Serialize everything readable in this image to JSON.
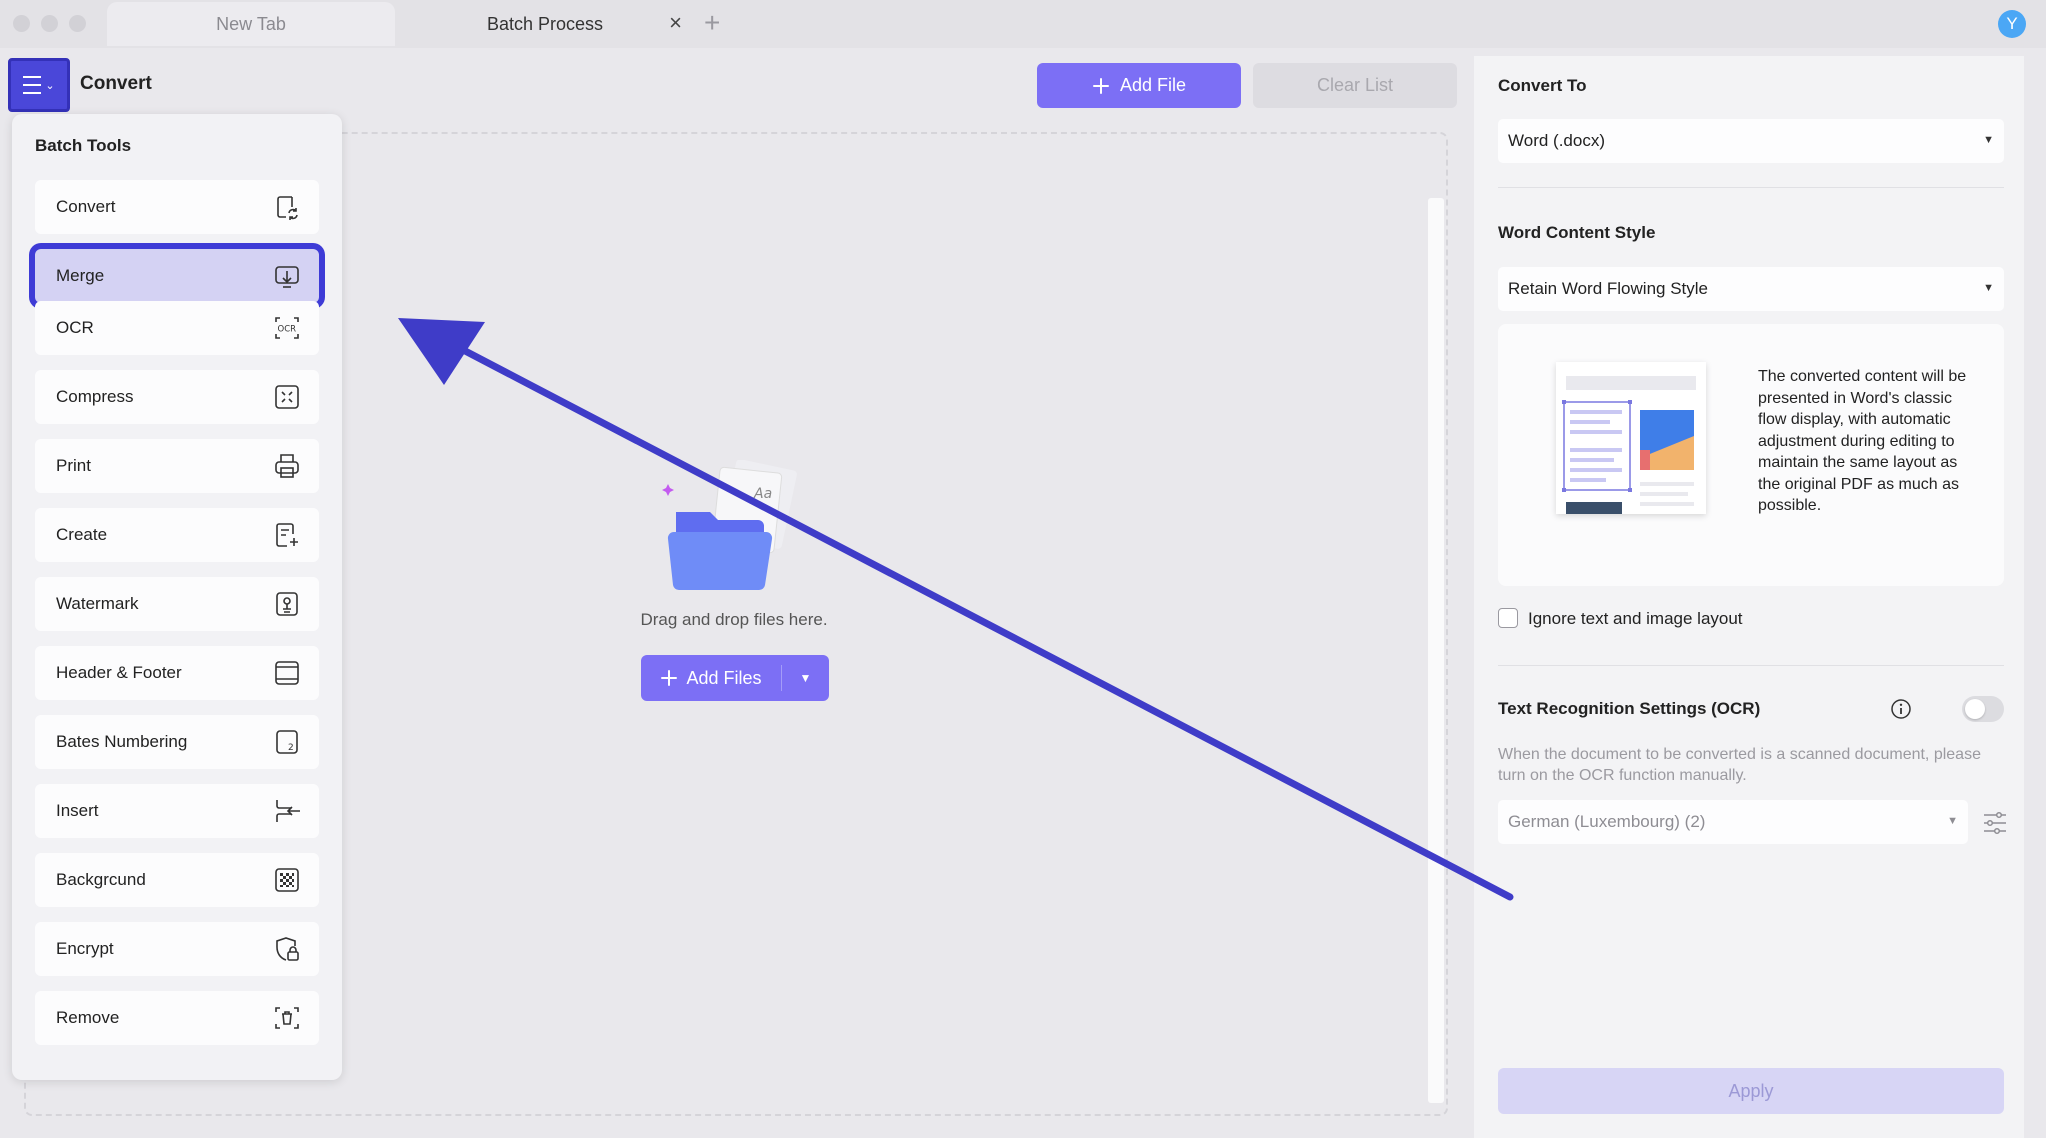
{
  "tabs": {
    "items": [
      {
        "label": "New Tab",
        "active": false
      },
      {
        "label": "Batch Process",
        "active": true
      }
    ],
    "close_icon": "×",
    "new_tab_icon": "+"
  },
  "user": {
    "avatar_initial": "Y",
    "avatar_color": "#4ba7f5"
  },
  "header": {
    "title": "Convert",
    "add_file_label": "Add File",
    "clear_list_label": "Clear List"
  },
  "dropzone": {
    "text": "Drag and drop files here.",
    "add_files_label": "Add Files"
  },
  "tools_panel": {
    "title": "Batch Tools",
    "selected": "Merge",
    "items": [
      {
        "label": "Convert",
        "icon": "convert-icon"
      },
      {
        "label": "Merge",
        "icon": "merge-icon"
      },
      {
        "label": "OCR",
        "icon": "ocr-icon"
      },
      {
        "label": "Compress",
        "icon": "compress-icon"
      },
      {
        "label": "Print",
        "icon": "print-icon"
      },
      {
        "label": "Create",
        "icon": "create-icon"
      },
      {
        "label": "Watermark",
        "icon": "watermark-icon"
      },
      {
        "label": "Header & Footer",
        "icon": "header-footer-icon"
      },
      {
        "label": "Bates Numbering",
        "icon": "bates-numbering-icon"
      },
      {
        "label": "Insert",
        "icon": "insert-icon"
      },
      {
        "label": "Backgrcund",
        "icon": "background-icon"
      },
      {
        "label": "Encrypt",
        "icon": "encrypt-icon"
      },
      {
        "label": "Remove",
        "icon": "remove-icon"
      }
    ]
  },
  "right_panel": {
    "convert_to_label": "Convert To",
    "convert_to_value": "Word (.docx)",
    "content_style_label": "Word Content Style",
    "content_style_value": "Retain Word Flowing Style",
    "preview_description": "The converted content will be presented in Word's classic flow display, with automatic adjustment during editing to maintain the same layout as the original PDF as much as possible.",
    "ignore_layout_label": "Ignore text and image layout",
    "ignore_layout_checked": false,
    "ocr_label": "Text Recognition Settings (OCR)",
    "ocr_enabled": false,
    "ocr_note": "When the document to be converted is a scanned document, please turn on the OCR function manually.",
    "ocr_language": "German (Luxembourg) (2)",
    "apply_label": "Apply"
  },
  "colors": {
    "accent": "#7c6ff5",
    "selection_border": "#3e3bd6",
    "menu_button": "#4a47d9",
    "annotation_arrow": "#3f3cc8"
  }
}
